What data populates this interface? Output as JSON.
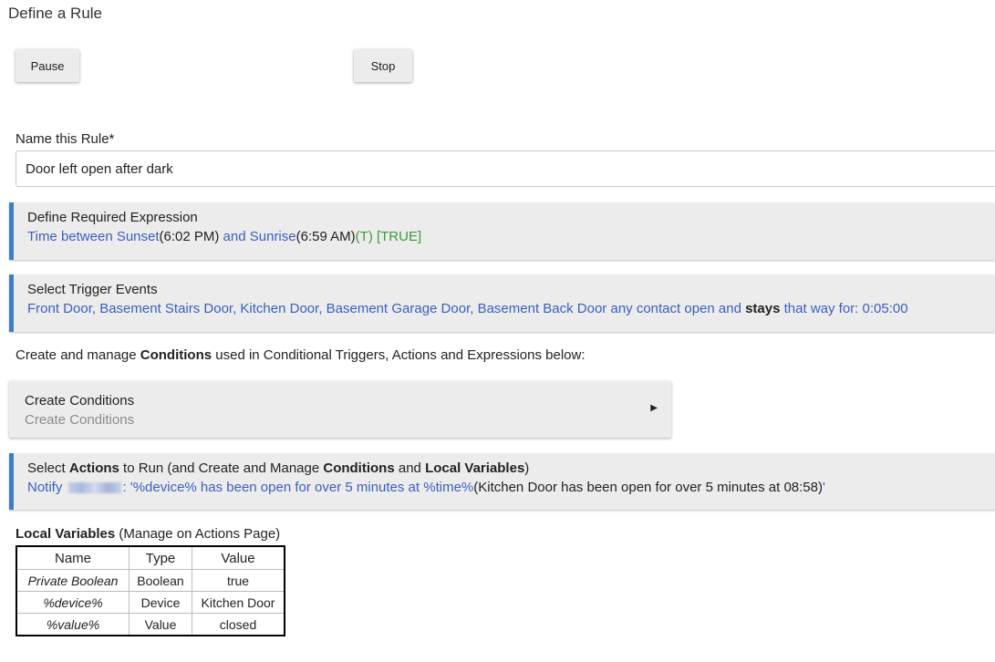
{
  "page": {
    "title": "Define a Rule"
  },
  "buttons": {
    "pause": "Pause",
    "stop": "Stop"
  },
  "name_field": {
    "label": "Name this Rule*",
    "value": "Door left open after dark"
  },
  "required_expression": {
    "title": "Define Required Expression",
    "part1": "Time between Sunset",
    "part2": "(6:02 PM)",
    "part3": " and Sunrise",
    "part4": "(6:59 AM)",
    "part5": "(T) [TRUE]"
  },
  "trigger_events": {
    "title": "Select Trigger Events",
    "detail_pre": "Front Door, Basement Stairs Door, Kitchen Door, Basement Garage Door, Basement Back Door any contact open and ",
    "detail_bold": "stays",
    "detail_post": " that way for: 0:05:00"
  },
  "conditions_note": {
    "pre": "Create and manage ",
    "bold": "Conditions",
    "post": " used in Conditional Triggers, Actions and Expressions below:"
  },
  "create_conditions": {
    "title": "Create Conditions",
    "subtitle": "Create Conditions",
    "arrow": "▶"
  },
  "actions": {
    "title_1": "Select ",
    "title_2": "Actions",
    "title_3": " to Run (and Create and Manage ",
    "title_4": "Conditions",
    "title_5": " and ",
    "title_6": "Local Variables",
    "title_7": ")",
    "detail_1": "Notify ",
    "detail_2": ": '%device% has been open for over  5 minutes at %time%",
    "detail_3": "(Kitchen Door has been open for over  5 minutes at 08:58)",
    "detail_4": "'"
  },
  "local_variables": {
    "label_bold": "Local Variables",
    "label_rest": " (Manage on Actions Page)",
    "headers": [
      "Name",
      "Type",
      "Value"
    ],
    "rows": [
      [
        "Private Boolean",
        "Boolean",
        "true"
      ],
      [
        "%device%",
        "Device",
        "Kitchen Door"
      ],
      [
        "%value%",
        "Value",
        "closed"
      ]
    ]
  },
  "colors": {
    "accent": "#3f7dc7",
    "link": "#3a5fc1",
    "true_green": "#3a9b3a",
    "panel": "#ececec"
  }
}
